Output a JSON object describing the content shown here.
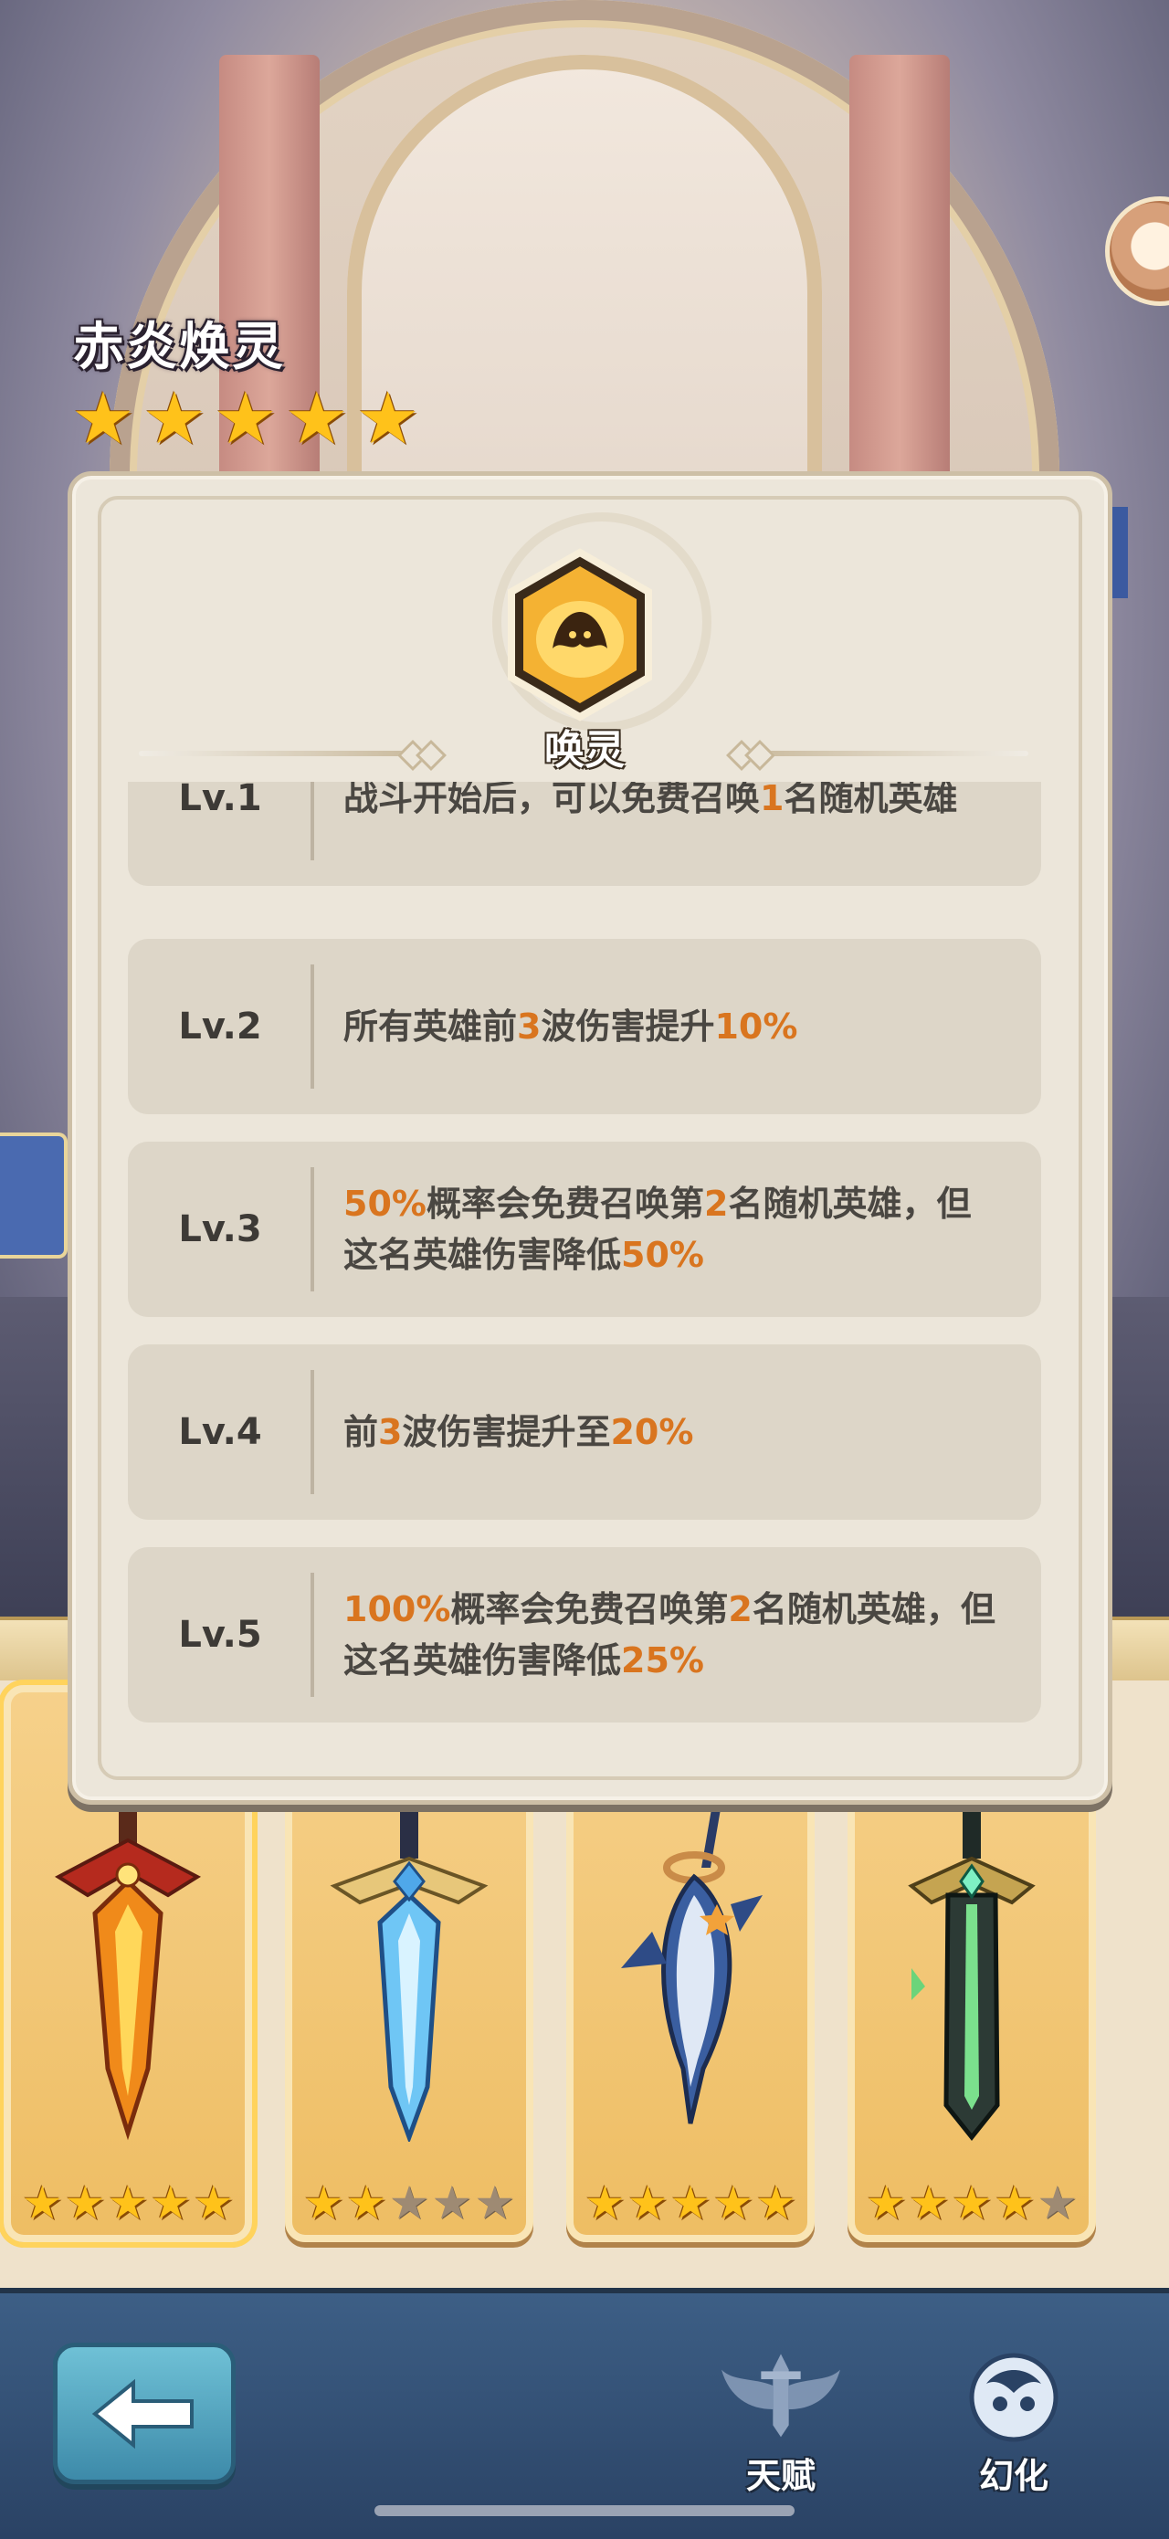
{
  "hero": {
    "name": "赤炎焕灵",
    "stars": 5
  },
  "popup": {
    "skill_name": "唤灵",
    "levels": [
      {
        "label": "Lv.1",
        "parts": [
          "战斗开始后，可以免费召唤",
          "1",
          "名随机英雄"
        ]
      },
      {
        "label": "Lv.2",
        "parts": [
          "所有英雄前",
          "3",
          "波伤害提升",
          "10%",
          ""
        ]
      },
      {
        "label": "Lv.3",
        "parts": [
          "",
          "50%",
          "概率会免费召唤第",
          "2",
          "名随机英雄，但这名英雄伤害降低",
          "50%",
          ""
        ]
      },
      {
        "label": "Lv.4",
        "parts": [
          "前",
          "3",
          "波伤害提升至",
          "20%",
          ""
        ]
      },
      {
        "label": "Lv.5",
        "parts": [
          "",
          "100%",
          "概率会免费召唤第",
          "2",
          "名随机英雄，但这名英雄伤害降低",
          "25%",
          ""
        ]
      }
    ]
  },
  "weapons": [
    {
      "name": "flame-sword",
      "stars": 5,
      "selected": true
    },
    {
      "name": "ice-sword",
      "stars": 2,
      "selected": false
    },
    {
      "name": "swordfish",
      "stars": 5,
      "selected": false
    },
    {
      "name": "jade-sword",
      "stars": 4,
      "selected": false
    }
  ],
  "max_stars": 5,
  "nav": {
    "back_icon": "arrow-left-icon",
    "talent_label": "天赋",
    "transform_label": "幻化"
  },
  "colors": {
    "highlight": "#d9751f",
    "star": "#ffc21a",
    "star_off": "#9e8a73"
  }
}
